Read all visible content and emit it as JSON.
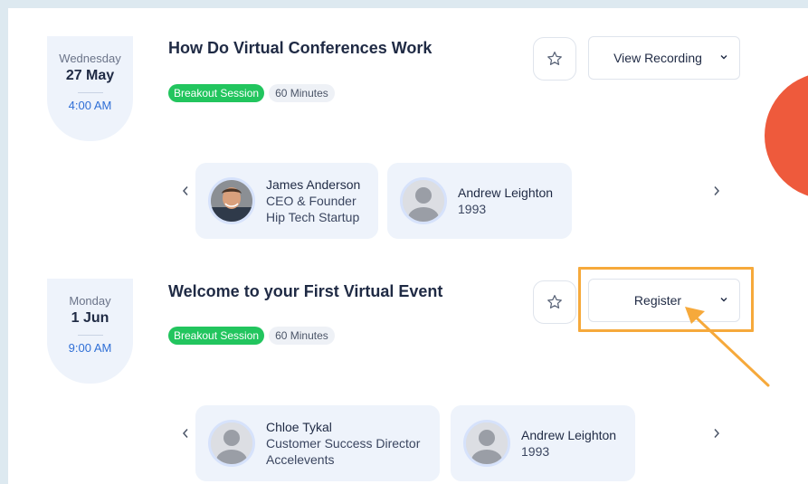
{
  "sessions": [
    {
      "weekday": "Wednesday",
      "day": "27 May",
      "time": "4:00 AM",
      "title": "How Do Virtual Conferences Work",
      "session_type": "Breakout Session",
      "duration": "60 Minutes",
      "action_label": "View Recording",
      "speakers": [
        {
          "name": "James Anderson",
          "line2": "CEO & Founder",
          "line3": "Hip Tech Startup"
        },
        {
          "name": "Andrew Leighton",
          "line2": "1993"
        }
      ]
    },
    {
      "weekday": "Monday",
      "day": "1 Jun",
      "time": "9:00 AM",
      "title": "Welcome to your First Virtual Event",
      "session_type": "Breakout Session",
      "duration": "60 Minutes",
      "action_label": "Register",
      "speakers": [
        {
          "name": "Chloe Tykal",
          "line2": "Customer Success Director",
          "line3": "Accelevents"
        },
        {
          "name": "Andrew Leighton",
          "line2": "1993"
        }
      ]
    }
  ],
  "colors": {
    "accent_green": "#22c55e",
    "time_blue": "#2f6fd6",
    "highlight_orange": "#f6a93b",
    "decor_red": "#ee5a3c"
  }
}
